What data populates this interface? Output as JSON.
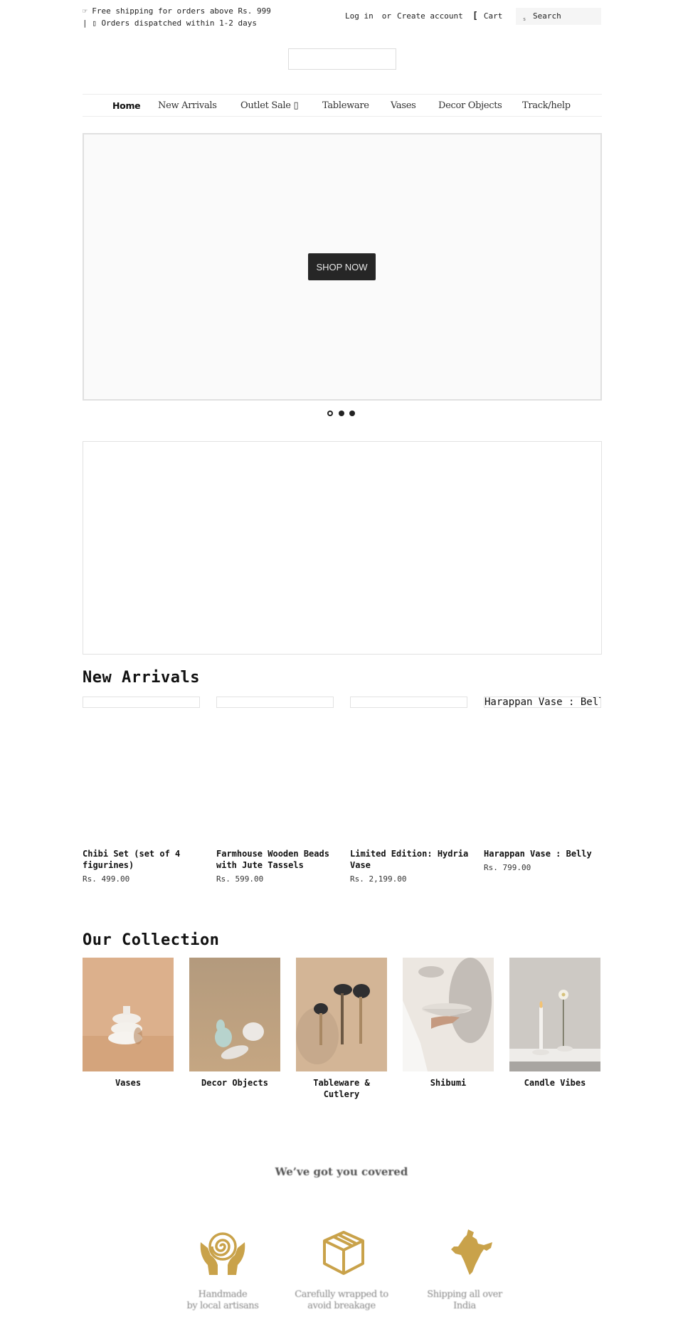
{
  "announcement": {
    "line1_icon": "☞",
    "line1": "Free shipping for orders above Rs. 999",
    "line2_prefix": "| ▯",
    "line2": "Orders dispatched within 1-2 days"
  },
  "account": {
    "login": "Log in",
    "or": "or",
    "create": "Create account"
  },
  "cart": {
    "icon": "[",
    "label": "Cart"
  },
  "search": {
    "icon": "s",
    "placeholder": "Search"
  },
  "nav": {
    "items": [
      {
        "label": "Home",
        "active": true
      },
      {
        "label": "New Arrivals"
      },
      {
        "label": "Outlet Sale ▯"
      },
      {
        "label": "Tableware"
      },
      {
        "label": "Vases"
      },
      {
        "label": "Decor Objects"
      },
      {
        "label": "Track/help"
      }
    ]
  },
  "hero": {
    "button": "SHOP NOW",
    "slides": 3,
    "active_slide": 1
  },
  "new_arrivals": {
    "title": "New Arrivals",
    "products": [
      {
        "image_alt": "",
        "name": "Chibi Set (set of 4 figurines)",
        "price": "Rs. 499.00"
      },
      {
        "image_alt": "",
        "name": "Farmhouse Wooden Beads with Jute Tassels",
        "price": "Rs. 599.00"
      },
      {
        "image_alt": "",
        "name": "Limited Edition: Hydria Vase",
        "price": "Rs. 2,199.00"
      },
      {
        "image_alt": "Harappan Vase : Belly",
        "name": "Harappan Vase : Belly",
        "price": "Rs. 799.00"
      }
    ]
  },
  "collection": {
    "title": "Our Collection",
    "items": [
      {
        "label": "Vases"
      },
      {
        "label": "Decor Objects"
      },
      {
        "label": "Tableware & Cutlery"
      },
      {
        "label": "Shibumi"
      },
      {
        "label": "Candle Vibes"
      }
    ]
  },
  "features": {
    "title": "We’ve got you covered",
    "accent": "#c9a24a",
    "items": [
      {
        "icon": "hands-spiral-icon",
        "line1": "Handmade",
        "line2": "by local artisans"
      },
      {
        "icon": "box-icon",
        "line1": "Carefully wrapped to",
        "line2": "avoid breakage"
      },
      {
        "icon": "india-map-icon",
        "line1": "Shipping all over",
        "line2": "India"
      }
    ]
  }
}
